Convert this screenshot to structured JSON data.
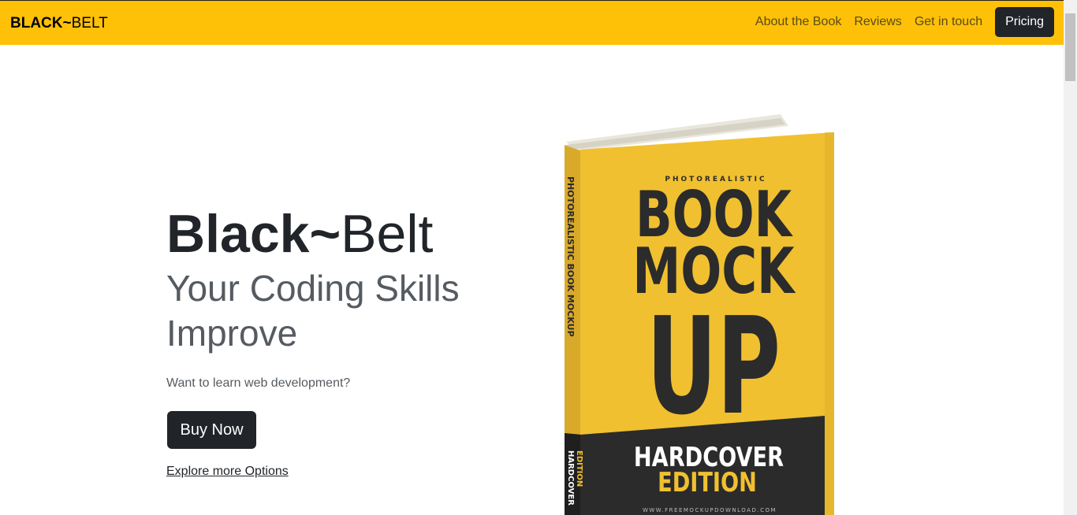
{
  "navbar": {
    "brand_bold": "BLACK~",
    "brand_light": "BELT",
    "links": [
      "About the Book",
      "Reviews",
      "Get in touch"
    ],
    "pricing_label": "Pricing"
  },
  "hero": {
    "title_bold": "Black~",
    "title_light": "Belt",
    "subtitle": "Your Coding Skills Improve",
    "lead": "Want to learn web development?",
    "buy_label": "Buy Now",
    "explore_label": "Explore more Options"
  },
  "book": {
    "top_tag": "PHOTOREALISTIC",
    "line1": "BOOK",
    "line2": "MOCK",
    "line3": "UP",
    "edition_line1": "HARDCOVER",
    "edition_line2": "EDITION",
    "spine_text": "PHOTOREALISTIC BOOK MOCKUP",
    "spine_edition_1": "HARDCOVER",
    "spine_edition_2": "EDITION",
    "url_text": "WWW.FREEMOCKUPDOWNLOAD.COM"
  },
  "colors": {
    "navbar_bg": "#ffc107",
    "dark": "#212529",
    "book_yellow": "#f0c030",
    "book_dark": "#2b2b2b"
  }
}
